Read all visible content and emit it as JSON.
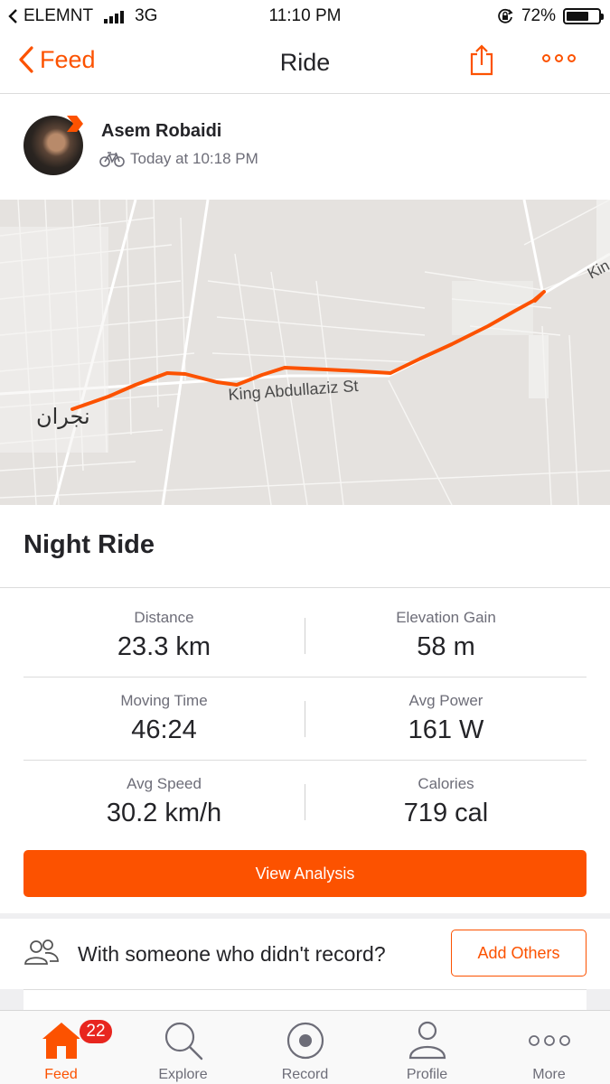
{
  "status_bar": {
    "carrier": "ELEMNT",
    "network": "3G",
    "time": "11:10 PM",
    "battery": "72%",
    "battery_level": 0.72
  },
  "nav": {
    "back_label": "Feed",
    "title": "Ride",
    "share_icon": "share-icon",
    "more_icon": "more-horizontal-icon",
    "accent_color": "#fc5200"
  },
  "athlete": {
    "name": "Asem Robaidi",
    "timestamp": "Today at 10:18 PM",
    "activity_icon": "bicycle-icon"
  },
  "map": {
    "city_label": "نجران",
    "street_label": "King Abdullaziz St",
    "edge_label": "Kin",
    "route_color": "#fc5200"
  },
  "activity": {
    "title": "Night Ride"
  },
  "stats": [
    {
      "left": {
        "label": "Distance",
        "value": "23.3 km"
      },
      "right": {
        "label": "Elevation Gain",
        "value": "58 m"
      }
    },
    {
      "left": {
        "label": "Moving Time",
        "value": "46:24"
      },
      "right": {
        "label": "Avg Power",
        "value": "161 W"
      }
    },
    {
      "left": {
        "label": "Avg Speed",
        "value": "30.2 km/h"
      },
      "right": {
        "label": "Calories",
        "value": "719 cal"
      }
    }
  ],
  "analysis_button": "View Analysis",
  "with_others": {
    "prompt": "With someone who didn't record?",
    "button": "Add Others"
  },
  "tabs": [
    {
      "label": "Feed",
      "icon": "home-icon",
      "active": true,
      "badge": "22"
    },
    {
      "label": "Explore",
      "icon": "search-icon",
      "active": false
    },
    {
      "label": "Record",
      "icon": "record-icon",
      "active": false
    },
    {
      "label": "Profile",
      "icon": "profile-icon",
      "active": false
    },
    {
      "label": "More",
      "icon": "more-horizontal-icon",
      "active": false
    }
  ]
}
